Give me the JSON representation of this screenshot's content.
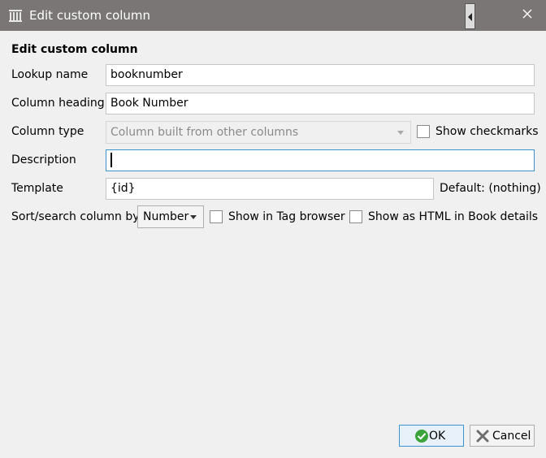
{
  "window": {
    "title": "Edit custom column",
    "close_icon": "close-icon",
    "app_icon": "library-icon"
  },
  "form": {
    "heading": "Edit custom column",
    "lookup_name": {
      "label": "Lookup name",
      "value": "booknumber"
    },
    "column_heading": {
      "label": "Column heading",
      "value": "Book Number"
    },
    "column_type": {
      "label": "Column type",
      "value": "Column built from other columns",
      "checkbox_label": "Show checkmarks",
      "checked": false
    },
    "description": {
      "label": "Description",
      "value": ""
    },
    "template": {
      "label": "Template",
      "value": "{id}",
      "default_text": "Default: (nothing)"
    },
    "sort_search": {
      "label": "Sort/search column by",
      "value": "Number",
      "options_visible": [
        "Number"
      ]
    },
    "show_in_tag_browser": {
      "label": "Show in Tag browser",
      "checked": false
    },
    "show_as_html": {
      "label": "Show as HTML in Book details",
      "checked": false
    }
  },
  "buttons": {
    "ok": "OK",
    "cancel": "Cancel"
  },
  "colors": {
    "titlebar": "#7a7675",
    "background": "#f0f0f0",
    "focus": "#3b93d1",
    "ok_check": "#3aa43a",
    "cancel_x": "#6e6e6e"
  }
}
